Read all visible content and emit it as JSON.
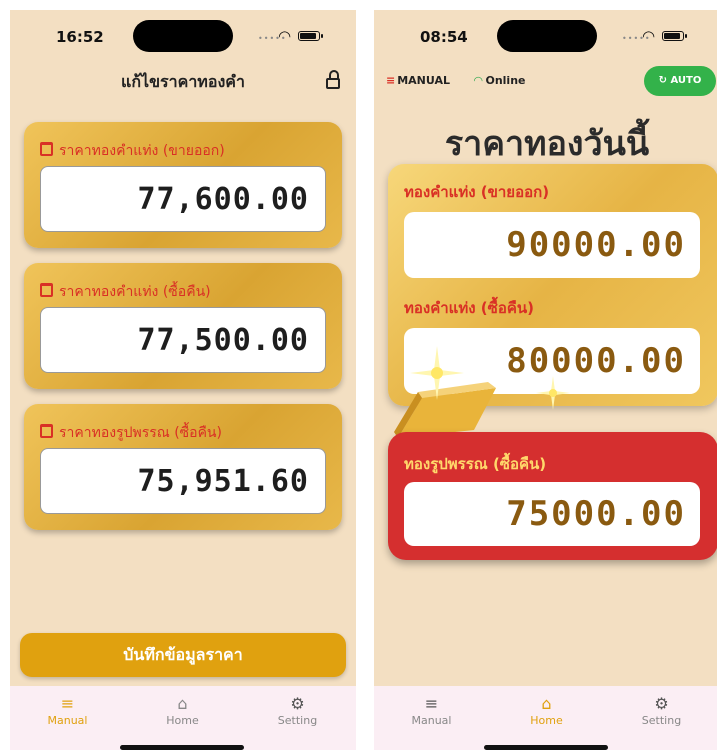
{
  "left": {
    "status": {
      "time": "16:52"
    },
    "nav_title": "แก้ไขราคาทองคำ",
    "cards": [
      {
        "label": "ราคาทองคำแท่ง (ขายออก)",
        "value": "77,600.00"
      },
      {
        "label": "ราคาทองคำแท่ง (ซื้อคืน)",
        "value": "77,500.00"
      },
      {
        "label": "ราคาทองรูปพรรณ (ซื้อคืน)",
        "value": "75,951.60"
      }
    ],
    "save_button": "บันทึกข้อมูลราคา",
    "tabs": [
      {
        "label": "Manual",
        "icon": "edit-icon",
        "active": true
      },
      {
        "label": "Home",
        "icon": "home-icon",
        "active": false
      },
      {
        "label": "Setting",
        "icon": "gear-icon",
        "active": false
      }
    ]
  },
  "right": {
    "status": {
      "time": "08:54"
    },
    "mode": "MANUAL",
    "connection": "Online",
    "auto_button": "AUTO",
    "title": "ราคาทองวันนี้",
    "bar_sell_label": "ทองคำแท่ง (ขายออก)",
    "bar_sell_value": "90000.00",
    "bar_buy_label": "ทองคำแท่ง (ซื้อคืน)",
    "bar_buy_value": "80000.00",
    "ornament_buy_label": "ทองรูปพรรณ (ซื้อคืน)",
    "ornament_buy_value": "75000.00",
    "tabs": [
      {
        "label": "Manual",
        "icon": "edit-icon",
        "active": false
      },
      {
        "label": "Home",
        "icon": "home-icon",
        "active": true
      },
      {
        "label": "Setting",
        "icon": "gear-icon",
        "active": false
      }
    ]
  },
  "colors": {
    "background": "#f3dfc2",
    "gold": "#e0a10f",
    "red": "#d52f2f",
    "label_red": "#d93025",
    "green": "#33b24a"
  }
}
